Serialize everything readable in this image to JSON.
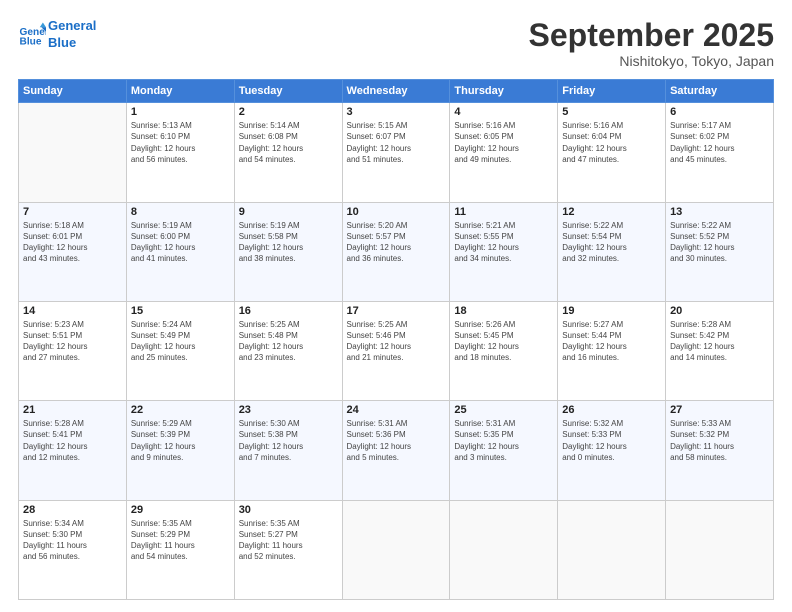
{
  "header": {
    "logo_line1": "General",
    "logo_line2": "Blue",
    "month": "September 2025",
    "location": "Nishitokyo, Tokyo, Japan"
  },
  "days_of_week": [
    "Sunday",
    "Monday",
    "Tuesday",
    "Wednesday",
    "Thursday",
    "Friday",
    "Saturday"
  ],
  "weeks": [
    [
      {
        "num": "",
        "info": ""
      },
      {
        "num": "1",
        "info": "Sunrise: 5:13 AM\nSunset: 6:10 PM\nDaylight: 12 hours\nand 56 minutes."
      },
      {
        "num": "2",
        "info": "Sunrise: 5:14 AM\nSunset: 6:08 PM\nDaylight: 12 hours\nand 54 minutes."
      },
      {
        "num": "3",
        "info": "Sunrise: 5:15 AM\nSunset: 6:07 PM\nDaylight: 12 hours\nand 51 minutes."
      },
      {
        "num": "4",
        "info": "Sunrise: 5:16 AM\nSunset: 6:05 PM\nDaylight: 12 hours\nand 49 minutes."
      },
      {
        "num": "5",
        "info": "Sunrise: 5:16 AM\nSunset: 6:04 PM\nDaylight: 12 hours\nand 47 minutes."
      },
      {
        "num": "6",
        "info": "Sunrise: 5:17 AM\nSunset: 6:02 PM\nDaylight: 12 hours\nand 45 minutes."
      }
    ],
    [
      {
        "num": "7",
        "info": "Sunrise: 5:18 AM\nSunset: 6:01 PM\nDaylight: 12 hours\nand 43 minutes."
      },
      {
        "num": "8",
        "info": "Sunrise: 5:19 AM\nSunset: 6:00 PM\nDaylight: 12 hours\nand 41 minutes."
      },
      {
        "num": "9",
        "info": "Sunrise: 5:19 AM\nSunset: 5:58 PM\nDaylight: 12 hours\nand 38 minutes."
      },
      {
        "num": "10",
        "info": "Sunrise: 5:20 AM\nSunset: 5:57 PM\nDaylight: 12 hours\nand 36 minutes."
      },
      {
        "num": "11",
        "info": "Sunrise: 5:21 AM\nSunset: 5:55 PM\nDaylight: 12 hours\nand 34 minutes."
      },
      {
        "num": "12",
        "info": "Sunrise: 5:22 AM\nSunset: 5:54 PM\nDaylight: 12 hours\nand 32 minutes."
      },
      {
        "num": "13",
        "info": "Sunrise: 5:22 AM\nSunset: 5:52 PM\nDaylight: 12 hours\nand 30 minutes."
      }
    ],
    [
      {
        "num": "14",
        "info": "Sunrise: 5:23 AM\nSunset: 5:51 PM\nDaylight: 12 hours\nand 27 minutes."
      },
      {
        "num": "15",
        "info": "Sunrise: 5:24 AM\nSunset: 5:49 PM\nDaylight: 12 hours\nand 25 minutes."
      },
      {
        "num": "16",
        "info": "Sunrise: 5:25 AM\nSunset: 5:48 PM\nDaylight: 12 hours\nand 23 minutes."
      },
      {
        "num": "17",
        "info": "Sunrise: 5:25 AM\nSunset: 5:46 PM\nDaylight: 12 hours\nand 21 minutes."
      },
      {
        "num": "18",
        "info": "Sunrise: 5:26 AM\nSunset: 5:45 PM\nDaylight: 12 hours\nand 18 minutes."
      },
      {
        "num": "19",
        "info": "Sunrise: 5:27 AM\nSunset: 5:44 PM\nDaylight: 12 hours\nand 16 minutes."
      },
      {
        "num": "20",
        "info": "Sunrise: 5:28 AM\nSunset: 5:42 PM\nDaylight: 12 hours\nand 14 minutes."
      }
    ],
    [
      {
        "num": "21",
        "info": "Sunrise: 5:28 AM\nSunset: 5:41 PM\nDaylight: 12 hours\nand 12 minutes."
      },
      {
        "num": "22",
        "info": "Sunrise: 5:29 AM\nSunset: 5:39 PM\nDaylight: 12 hours\nand 9 minutes."
      },
      {
        "num": "23",
        "info": "Sunrise: 5:30 AM\nSunset: 5:38 PM\nDaylight: 12 hours\nand 7 minutes."
      },
      {
        "num": "24",
        "info": "Sunrise: 5:31 AM\nSunset: 5:36 PM\nDaylight: 12 hours\nand 5 minutes."
      },
      {
        "num": "25",
        "info": "Sunrise: 5:31 AM\nSunset: 5:35 PM\nDaylight: 12 hours\nand 3 minutes."
      },
      {
        "num": "26",
        "info": "Sunrise: 5:32 AM\nSunset: 5:33 PM\nDaylight: 12 hours\nand 0 minutes."
      },
      {
        "num": "27",
        "info": "Sunrise: 5:33 AM\nSunset: 5:32 PM\nDaylight: 11 hours\nand 58 minutes."
      }
    ],
    [
      {
        "num": "28",
        "info": "Sunrise: 5:34 AM\nSunset: 5:30 PM\nDaylight: 11 hours\nand 56 minutes."
      },
      {
        "num": "29",
        "info": "Sunrise: 5:35 AM\nSunset: 5:29 PM\nDaylight: 11 hours\nand 54 minutes."
      },
      {
        "num": "30",
        "info": "Sunrise: 5:35 AM\nSunset: 5:27 PM\nDaylight: 11 hours\nand 52 minutes."
      },
      {
        "num": "",
        "info": ""
      },
      {
        "num": "",
        "info": ""
      },
      {
        "num": "",
        "info": ""
      },
      {
        "num": "",
        "info": ""
      }
    ]
  ]
}
